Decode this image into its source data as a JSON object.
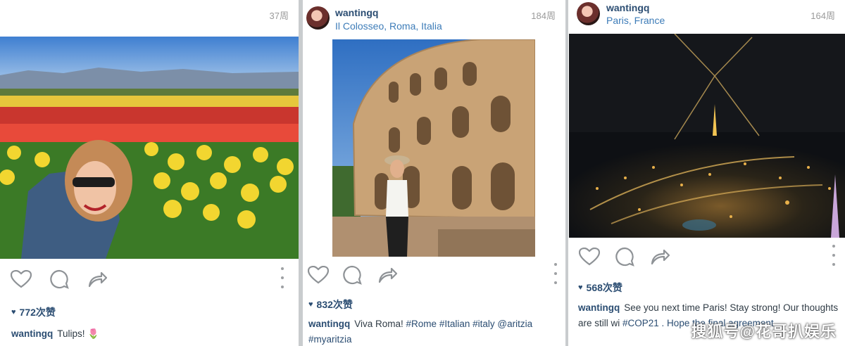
{
  "posts": [
    {
      "username": "",
      "location": "",
      "age": "37周",
      "likes": "772次赞",
      "caption_user": "wantingq",
      "caption_text": "Tulips! 🌷",
      "icons": [
        "heart-outline-icon",
        "comment-bubble-icon",
        "share-arrow-icon",
        "more-vertical-icon"
      ]
    },
    {
      "username": "wantingq",
      "location": "Il Colosseo, Roma, Italia",
      "age": "184周",
      "likes": "832次赞",
      "caption_user": "wantingq",
      "caption_text": "Viva Roma!",
      "caption_tags": "#Rome #Italian #italy @aritzia #myaritzia",
      "icons": [
        "heart-outline-icon",
        "comment-bubble-icon",
        "share-arrow-icon",
        "more-vertical-icon"
      ]
    },
    {
      "username": "wantingq",
      "location": "Paris, France",
      "age": "164周",
      "likes": "568次赞",
      "caption_user": "wantingq",
      "caption_text": "See you next time Paris! Stay strong! Our thoughts are still wi",
      "caption_tags": "#COP21 . Hope the final agreement",
      "icons": [
        "heart-outline-icon",
        "comment-bubble-icon",
        "share-arrow-icon",
        "more-vertical-icon"
      ]
    }
  ],
  "watermark": "搜狐号@花哥扒娱乐",
  "colors": {
    "username": "#2b4d72",
    "location": "#3d7cb8",
    "icon": "#8e9296",
    "background": "#c9ccce"
  }
}
